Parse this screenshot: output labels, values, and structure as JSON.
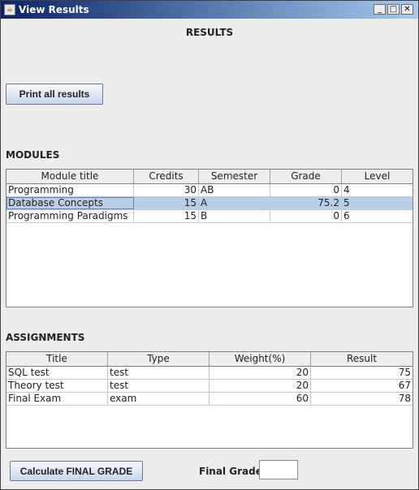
{
  "window": {
    "title": "View Results"
  },
  "header": {
    "title": "RESULTS"
  },
  "toolbar": {
    "print_label": "Print all results"
  },
  "modules": {
    "label": "MODULES",
    "columns": [
      "Module title",
      "Credits",
      "Semester",
      "Grade",
      "Level"
    ],
    "rows": [
      [
        "Programming",
        "30",
        "AB",
        "0",
        "4"
      ],
      [
        "Database Concepts",
        "15",
        "A",
        "75.2",
        "5"
      ],
      [
        "Programming Paradigms",
        "15",
        "B",
        "0",
        "6"
      ]
    ],
    "selected_row": 1
  },
  "assignments": {
    "label": "ASSIGNMENTS",
    "columns": [
      "Title",
      "Type",
      "Weight(%)",
      "Result"
    ],
    "rows": [
      [
        "SQL test",
        "test",
        "20",
        "75"
      ],
      [
        "Theory test",
        "test",
        "20",
        "67"
      ],
      [
        "Final Exam",
        "exam",
        "60",
        "78"
      ]
    ]
  },
  "footer": {
    "calculate_label": "Calculate FINAL GRADE",
    "final_grade_label": "Final Grade:",
    "final_grade_value": ""
  },
  "icons": {
    "app": "java-cup-icon",
    "minimize": "minimize-icon",
    "maximize": "maximize-icon",
    "close": "close-icon"
  }
}
